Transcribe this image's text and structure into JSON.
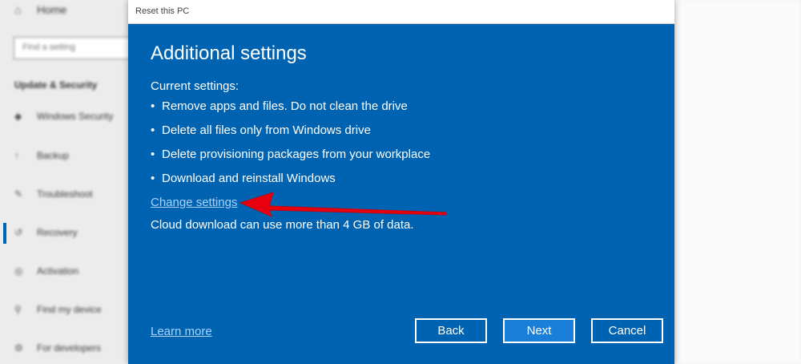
{
  "background": {
    "sidebar": {
      "home": {
        "icon": "home-icon",
        "label": "Home"
      },
      "search_placeholder": "Find a setting",
      "section_title": "Update & Security",
      "items": [
        {
          "icon": "shield-icon",
          "label": "Windows Security"
        },
        {
          "icon": "backup-icon",
          "label": "Backup"
        },
        {
          "icon": "wrench-icon",
          "label": "Troubleshoot"
        },
        {
          "icon": "recovery-icon",
          "label": "Recovery"
        },
        {
          "icon": "activation-icon",
          "label": "Activation"
        },
        {
          "icon": "find-device-icon",
          "label": "Find my device"
        },
        {
          "icon": "developer-icon",
          "label": "For developers"
        }
      ]
    }
  },
  "dialog": {
    "window_title": "Reset this PC",
    "heading": "Additional settings",
    "current_settings_label": "Current settings:",
    "bullets": [
      "Remove apps and files. Do not clean the drive",
      "Delete all files only from Windows drive",
      "Delete provisioning packages from your workplace",
      "Download and reinstall Windows"
    ],
    "change_settings_link": "Change settings",
    "cloud_note": "Cloud download can use more than 4 GB of data.",
    "learn_more_link": "Learn more",
    "buttons": {
      "back": "Back",
      "next": "Next",
      "cancel": "Cancel"
    }
  },
  "colors": {
    "dialog_background": "#0063b1",
    "link": "#a8d3ff",
    "annotation_arrow": "#e8000e"
  }
}
